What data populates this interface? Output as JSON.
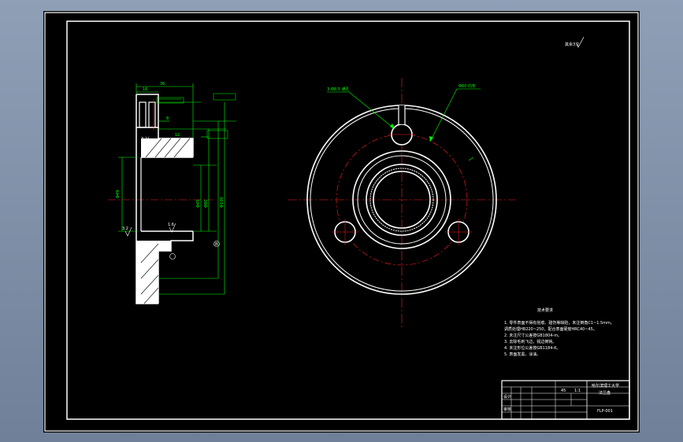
{
  "colors": {
    "background": "#000000",
    "outline": "#ffffff",
    "centerline": "#ff2020",
    "dimension": "#00ff00",
    "section_fill": "#ffffff"
  },
  "roughness_mark": "其余3.2",
  "front_view": {
    "callout_hole": "3-Φ8.5 通孔",
    "callout_pcd": "Φ60 均布"
  },
  "section_view": {
    "dim_top": "36",
    "dim_a": "16",
    "dim_b": "8",
    "dim_hub": "12",
    "dim_d1": "Φ49",
    "dim_d2": "Φ45",
    "dim_d3": "Φ80",
    "dim_d4": "Φ100",
    "rough_a": "3.2",
    "rough_b": "3.2",
    "rough_c": "1.6",
    "datum": "B"
  },
  "tech_requirements": {
    "title": "技术要求",
    "lines": [
      "1. 零件表面不得有划痕、碰伤等缺陷，未注倒角C1~1.5mm。",
      "   调质处理HB220~250，配合表面硬度HRC40~45。",
      "2. 未注尺寸公差按GB1804-m。",
      "3. 去除毛刺飞边，锐边倒钝。",
      "4. 未注形位公差按GB1184-K。",
      "5. 表面发黑，涂油。"
    ]
  },
  "title_block": {
    "material": "45",
    "scale": "1:1",
    "school": "哈尔滨理工大学",
    "part_name": "法兰盘",
    "drawing_no": "FLP-001",
    "designer": "设计",
    "checker": "审核"
  }
}
